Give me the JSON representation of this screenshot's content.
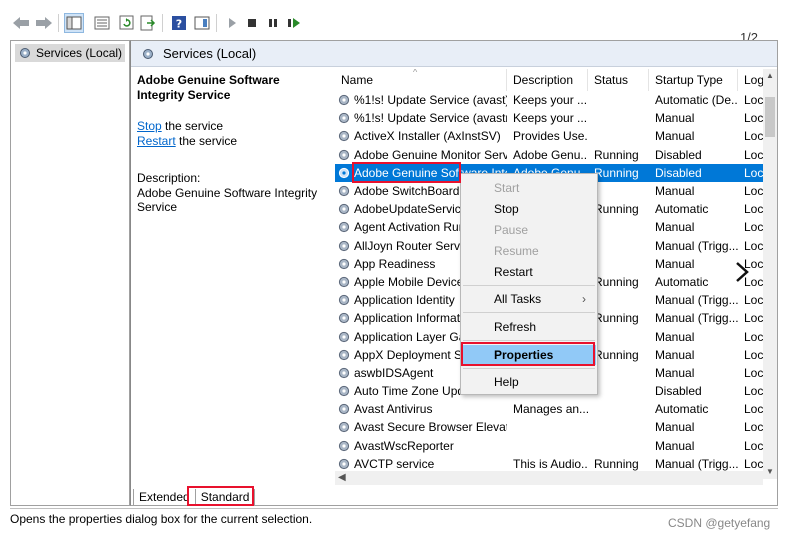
{
  "pager": "1/2",
  "tree": {
    "root_label": "Services (Local)"
  },
  "header": {
    "title": "Services (Local)"
  },
  "description": {
    "service_title": "Adobe Genuine Software Integrity Service",
    "stop_link": "Stop",
    "stop_suffix": " the service",
    "restart_link": "Restart",
    "restart_suffix": " the service",
    "description_label": "Description:",
    "description_text": "Adobe Genuine Software Integrity Service"
  },
  "columns": {
    "name": "Name",
    "description": "Description",
    "status": "Status",
    "startup_type": "Startup Type",
    "log_on": "Log"
  },
  "rows": [
    {
      "name": "%1!s! Update Service (avast)",
      "description": "Keeps your ...",
      "status": "",
      "startup": "Automatic (De...",
      "logon": "Loc"
    },
    {
      "name": "%1!s! Update Service (avastm)",
      "description": "Keeps your ...",
      "status": "",
      "startup": "Manual",
      "logon": "Loc"
    },
    {
      "name": "ActiveX Installer (AxInstSV)",
      "description": "Provides Use...",
      "status": "",
      "startup": "Manual",
      "logon": "Loc"
    },
    {
      "name": "Adobe Genuine Monitor Serv...",
      "description": "Adobe Genu...",
      "status": "Running",
      "startup": "Disabled",
      "logon": "Loc"
    },
    {
      "name": "Adobe Genuine Software Inte...",
      "description": "Adobe Genu...",
      "status": "Running",
      "startup": "Disabled",
      "logon": "Loc"
    },
    {
      "name": "Adobe SwitchBoard",
      "description": "",
      "status": "",
      "startup": "Manual",
      "logon": "Loc"
    },
    {
      "name": "AdobeUpdateService",
      "description": "",
      "status": "Running",
      "startup": "Automatic",
      "logon": "Loc"
    },
    {
      "name": "Agent Activation Runt",
      "description": "",
      "status": "",
      "startup": "Manual",
      "logon": "Loc"
    },
    {
      "name": "AllJoyn Router Service",
      "description": "",
      "status": "",
      "startup": "Manual (Trigg...",
      "logon": "Loc"
    },
    {
      "name": "App Readiness",
      "description": "",
      "status": "",
      "startup": "Manual",
      "logon": "Loc"
    },
    {
      "name": "Apple Mobile Device",
      "description": "",
      "status": "Running",
      "startup": "Automatic",
      "logon": "Loc"
    },
    {
      "name": "Application Identity",
      "description": "",
      "status": "",
      "startup": "Manual (Trigg...",
      "logon": "Loc"
    },
    {
      "name": "Application Informatio",
      "description": "",
      "status": "Running",
      "startup": "Manual (Trigg...",
      "logon": "Loc"
    },
    {
      "name": "Application Layer Gat",
      "description": "",
      "status": "",
      "startup": "Manual",
      "logon": "Loc"
    },
    {
      "name": "AppX Deployment Se",
      "description": "",
      "status": "Running",
      "startup": "Manual",
      "logon": "Loc"
    },
    {
      "name": "aswbIDSAgent",
      "description": "",
      "status": "",
      "startup": "Manual",
      "logon": "Loc"
    },
    {
      "name": "Auto Time Zone Upda",
      "description": "",
      "status": "",
      "startup": "Disabled",
      "logon": "Loc"
    },
    {
      "name": "Avast Antivirus",
      "description": "Manages an...",
      "status": "",
      "startup": "Automatic",
      "logon": "Loc"
    },
    {
      "name": "Avast Secure Browser Elevati...",
      "description": "",
      "status": "",
      "startup": "Manual",
      "logon": "Loc"
    },
    {
      "name": "AvastWscReporter",
      "description": "",
      "status": "",
      "startup": "Manual",
      "logon": "Loc"
    },
    {
      "name": "AVCTP service",
      "description": "This is Audio...",
      "status": "Running",
      "startup": "Manual (Trigg...",
      "logon": "Loc"
    }
  ],
  "context_menu": {
    "start": "Start",
    "stop": "Stop",
    "pause": "Pause",
    "resume": "Resume",
    "restart": "Restart",
    "all_tasks": "All Tasks",
    "refresh": "Refresh",
    "properties": "Properties",
    "help": "Help"
  },
  "tabs": {
    "extended": "Extended",
    "standard": "Standard"
  },
  "status_bar": "Opens the properties dialog box for the current selection.",
  "watermark": "CSDN @getyefang",
  "colors": {
    "selection": "#0078d7",
    "highlight_box": "#e8112d",
    "menu_highlight": "#91c9f7"
  }
}
